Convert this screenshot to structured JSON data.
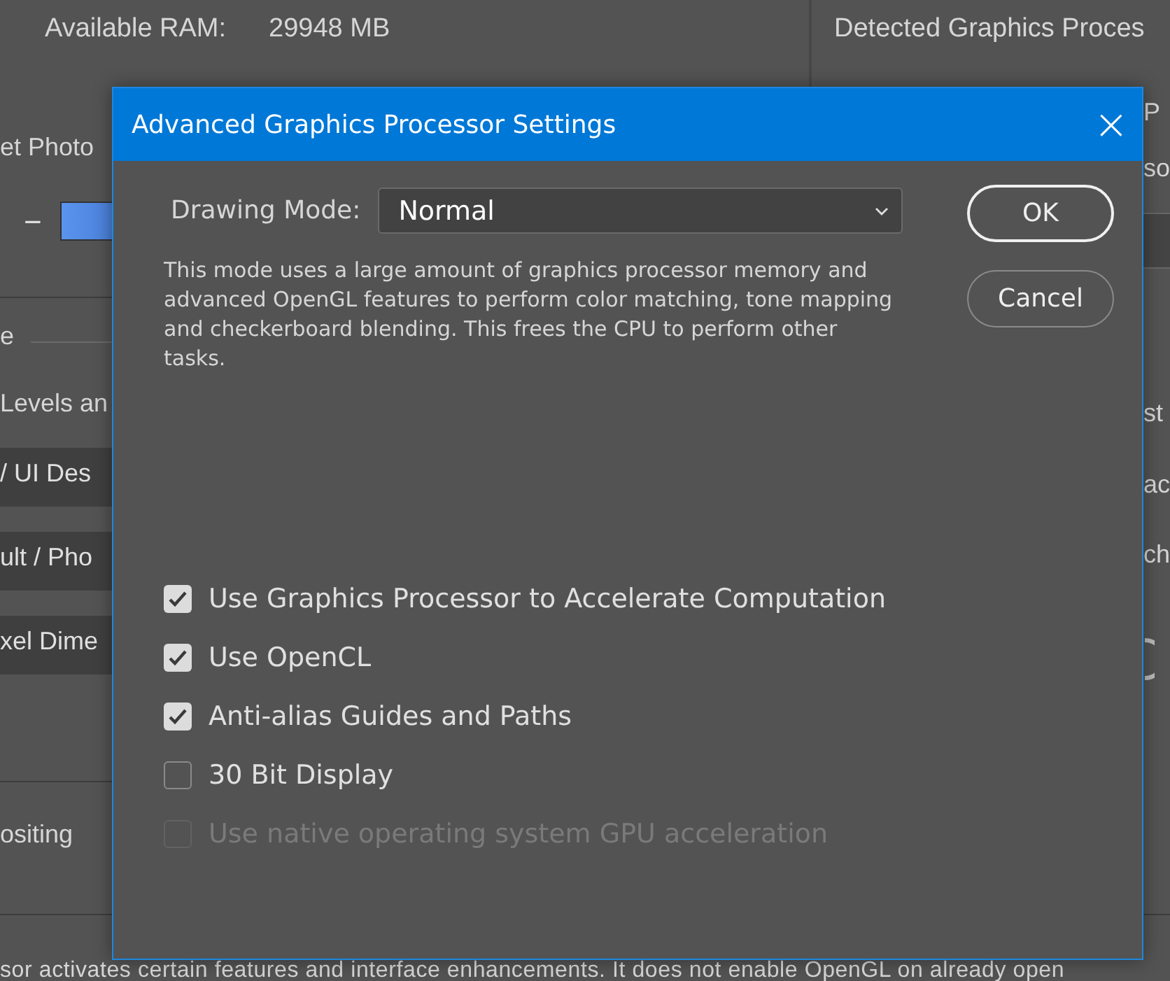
{
  "background": {
    "ram_label": "Available RAM:",
    "ram_value": "29948 MB",
    "gpu_heading": "Detected Graphics Proces",
    "left_fragments": [
      "et Photo",
      "−",
      "e",
      "Levels an",
      "/ UI Des",
      "ult / Pho",
      "xel Dime",
      "ositing"
    ],
    "right_fragments": [
      "P",
      "so",
      "st",
      "ac",
      "ch"
    ],
    "footer": "sor activates certain features and interface enhancements. It does not enable OpenGL on already open"
  },
  "dialog": {
    "title": "Advanced Graphics Processor Settings",
    "close": "×",
    "drawing_mode_label": "Drawing Mode:",
    "drawing_mode_value": "Normal",
    "description": "This mode uses a large amount of graphics processor memory and advanced OpenGL features to perform color matching, tone mapping and checkerboard blending.  This frees the CPU to perform other tasks.",
    "buttons": [
      {
        "label": "OK",
        "default": true
      },
      {
        "label": "Cancel",
        "default": false
      }
    ],
    "options": [
      {
        "label": "Use Graphics Processor to Accelerate Computation",
        "checked": true,
        "disabled": false
      },
      {
        "label": "Use OpenCL",
        "checked": true,
        "disabled": false
      },
      {
        "label": "Anti-alias Guides and Paths",
        "checked": true,
        "disabled": false
      },
      {
        "label": "30 Bit Display",
        "checked": false,
        "disabled": false
      },
      {
        "label": "Use native operating system GPU acceleration",
        "checked": false,
        "disabled": true
      }
    ]
  }
}
